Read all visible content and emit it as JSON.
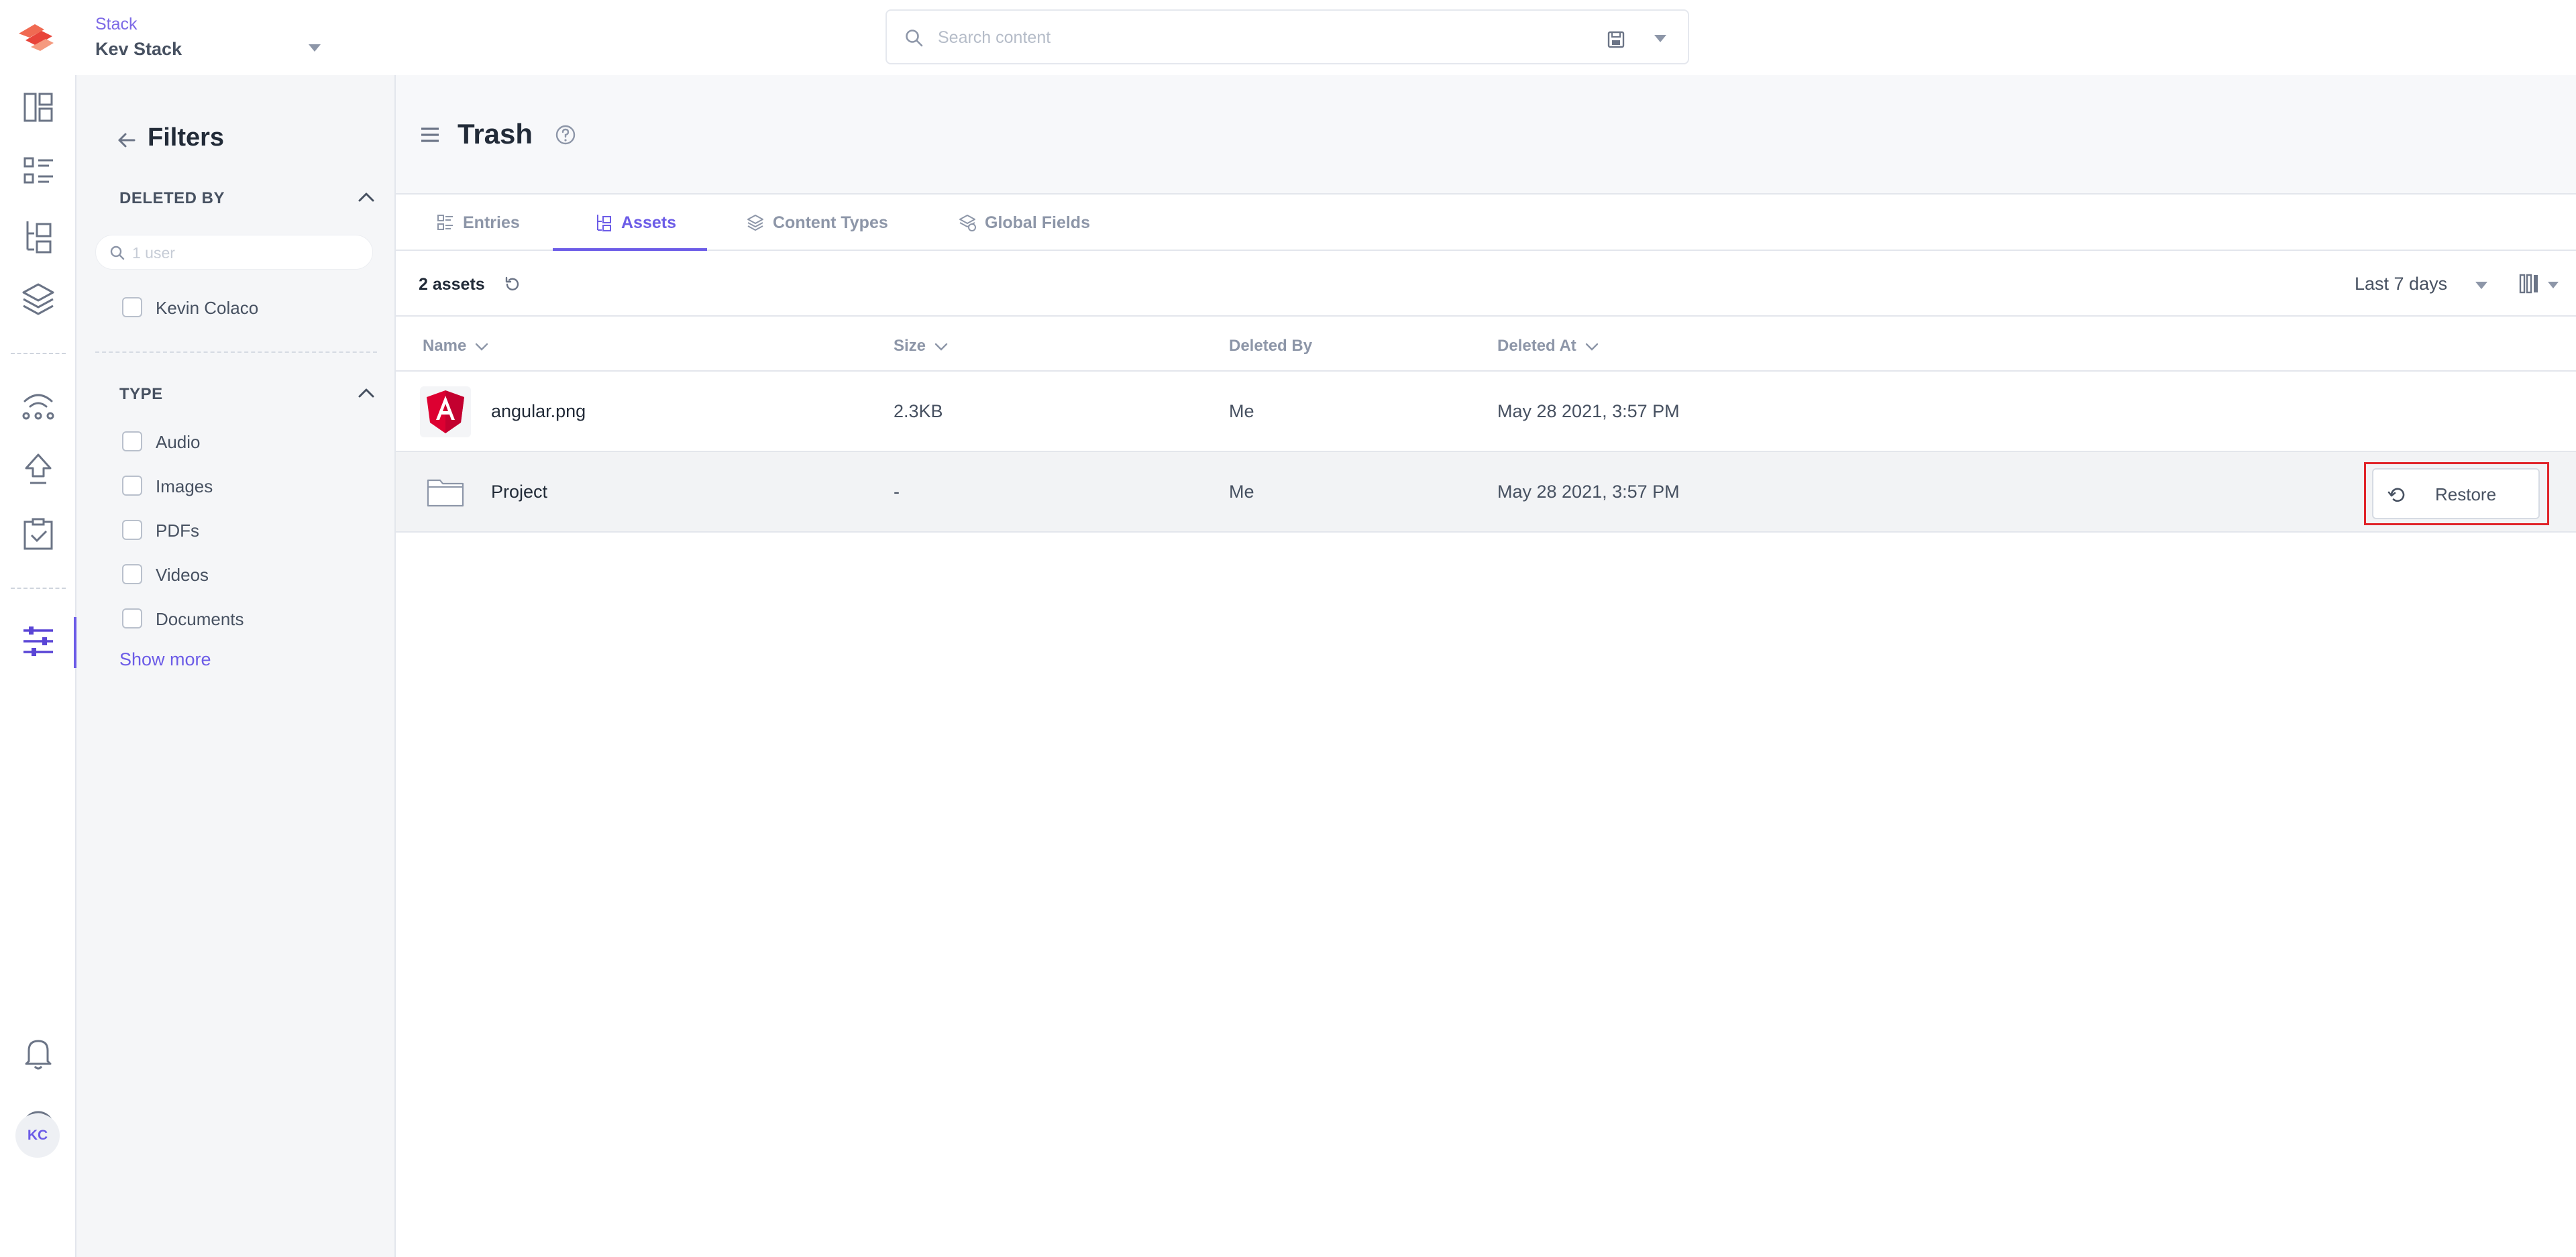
{
  "topbar": {
    "stack_caption": "Stack",
    "stack_name": "Kev Stack",
    "search_placeholder": "Search content"
  },
  "rail": {
    "avatar_initials": "KC",
    "icons": [
      "dashboard-icon",
      "entries-icon",
      "assets-icon",
      "content-models-icon",
      "releases-icon",
      "publish-queue-icon",
      "tasks-icon",
      "settings-icon",
      "notifications-icon",
      "help-icon"
    ]
  },
  "filters": {
    "title": "Filters",
    "deleted_by": {
      "heading": "DELETED BY",
      "search_placeholder": "1 user",
      "users": [
        "Kevin Colaco"
      ]
    },
    "type": {
      "heading": "TYPE",
      "options": [
        "Audio",
        "Images",
        "PDFs",
        "Videos",
        "Documents"
      ],
      "show_more": "Show more"
    }
  },
  "page": {
    "title": "Trash"
  },
  "tabs": [
    {
      "label": "Entries",
      "active": false
    },
    {
      "label": "Assets",
      "active": true
    },
    {
      "label": "Content Types",
      "active": false
    },
    {
      "label": "Global Fields",
      "active": false
    }
  ],
  "toolbar": {
    "count_label": "2 assets",
    "date_range": "Last 7 days"
  },
  "table": {
    "columns": [
      "Name",
      "Size",
      "Deleted By",
      "Deleted At"
    ],
    "rows": [
      {
        "name": "angular.png",
        "size": "2.3KB",
        "deleted_by": "Me",
        "deleted_at": "May 28 2021, 3:57 PM",
        "thumb": "angular-logo-icon"
      },
      {
        "name": "Project",
        "size": "-",
        "deleted_by": "Me",
        "deleted_at": "May 28 2021, 3:57 PM",
        "thumb": "folder-icon"
      }
    ],
    "restore_label": "Restore"
  },
  "colors": {
    "accent": "#6c5ce7",
    "highlight": "#e0242a",
    "angular_red": "#dd0031"
  }
}
